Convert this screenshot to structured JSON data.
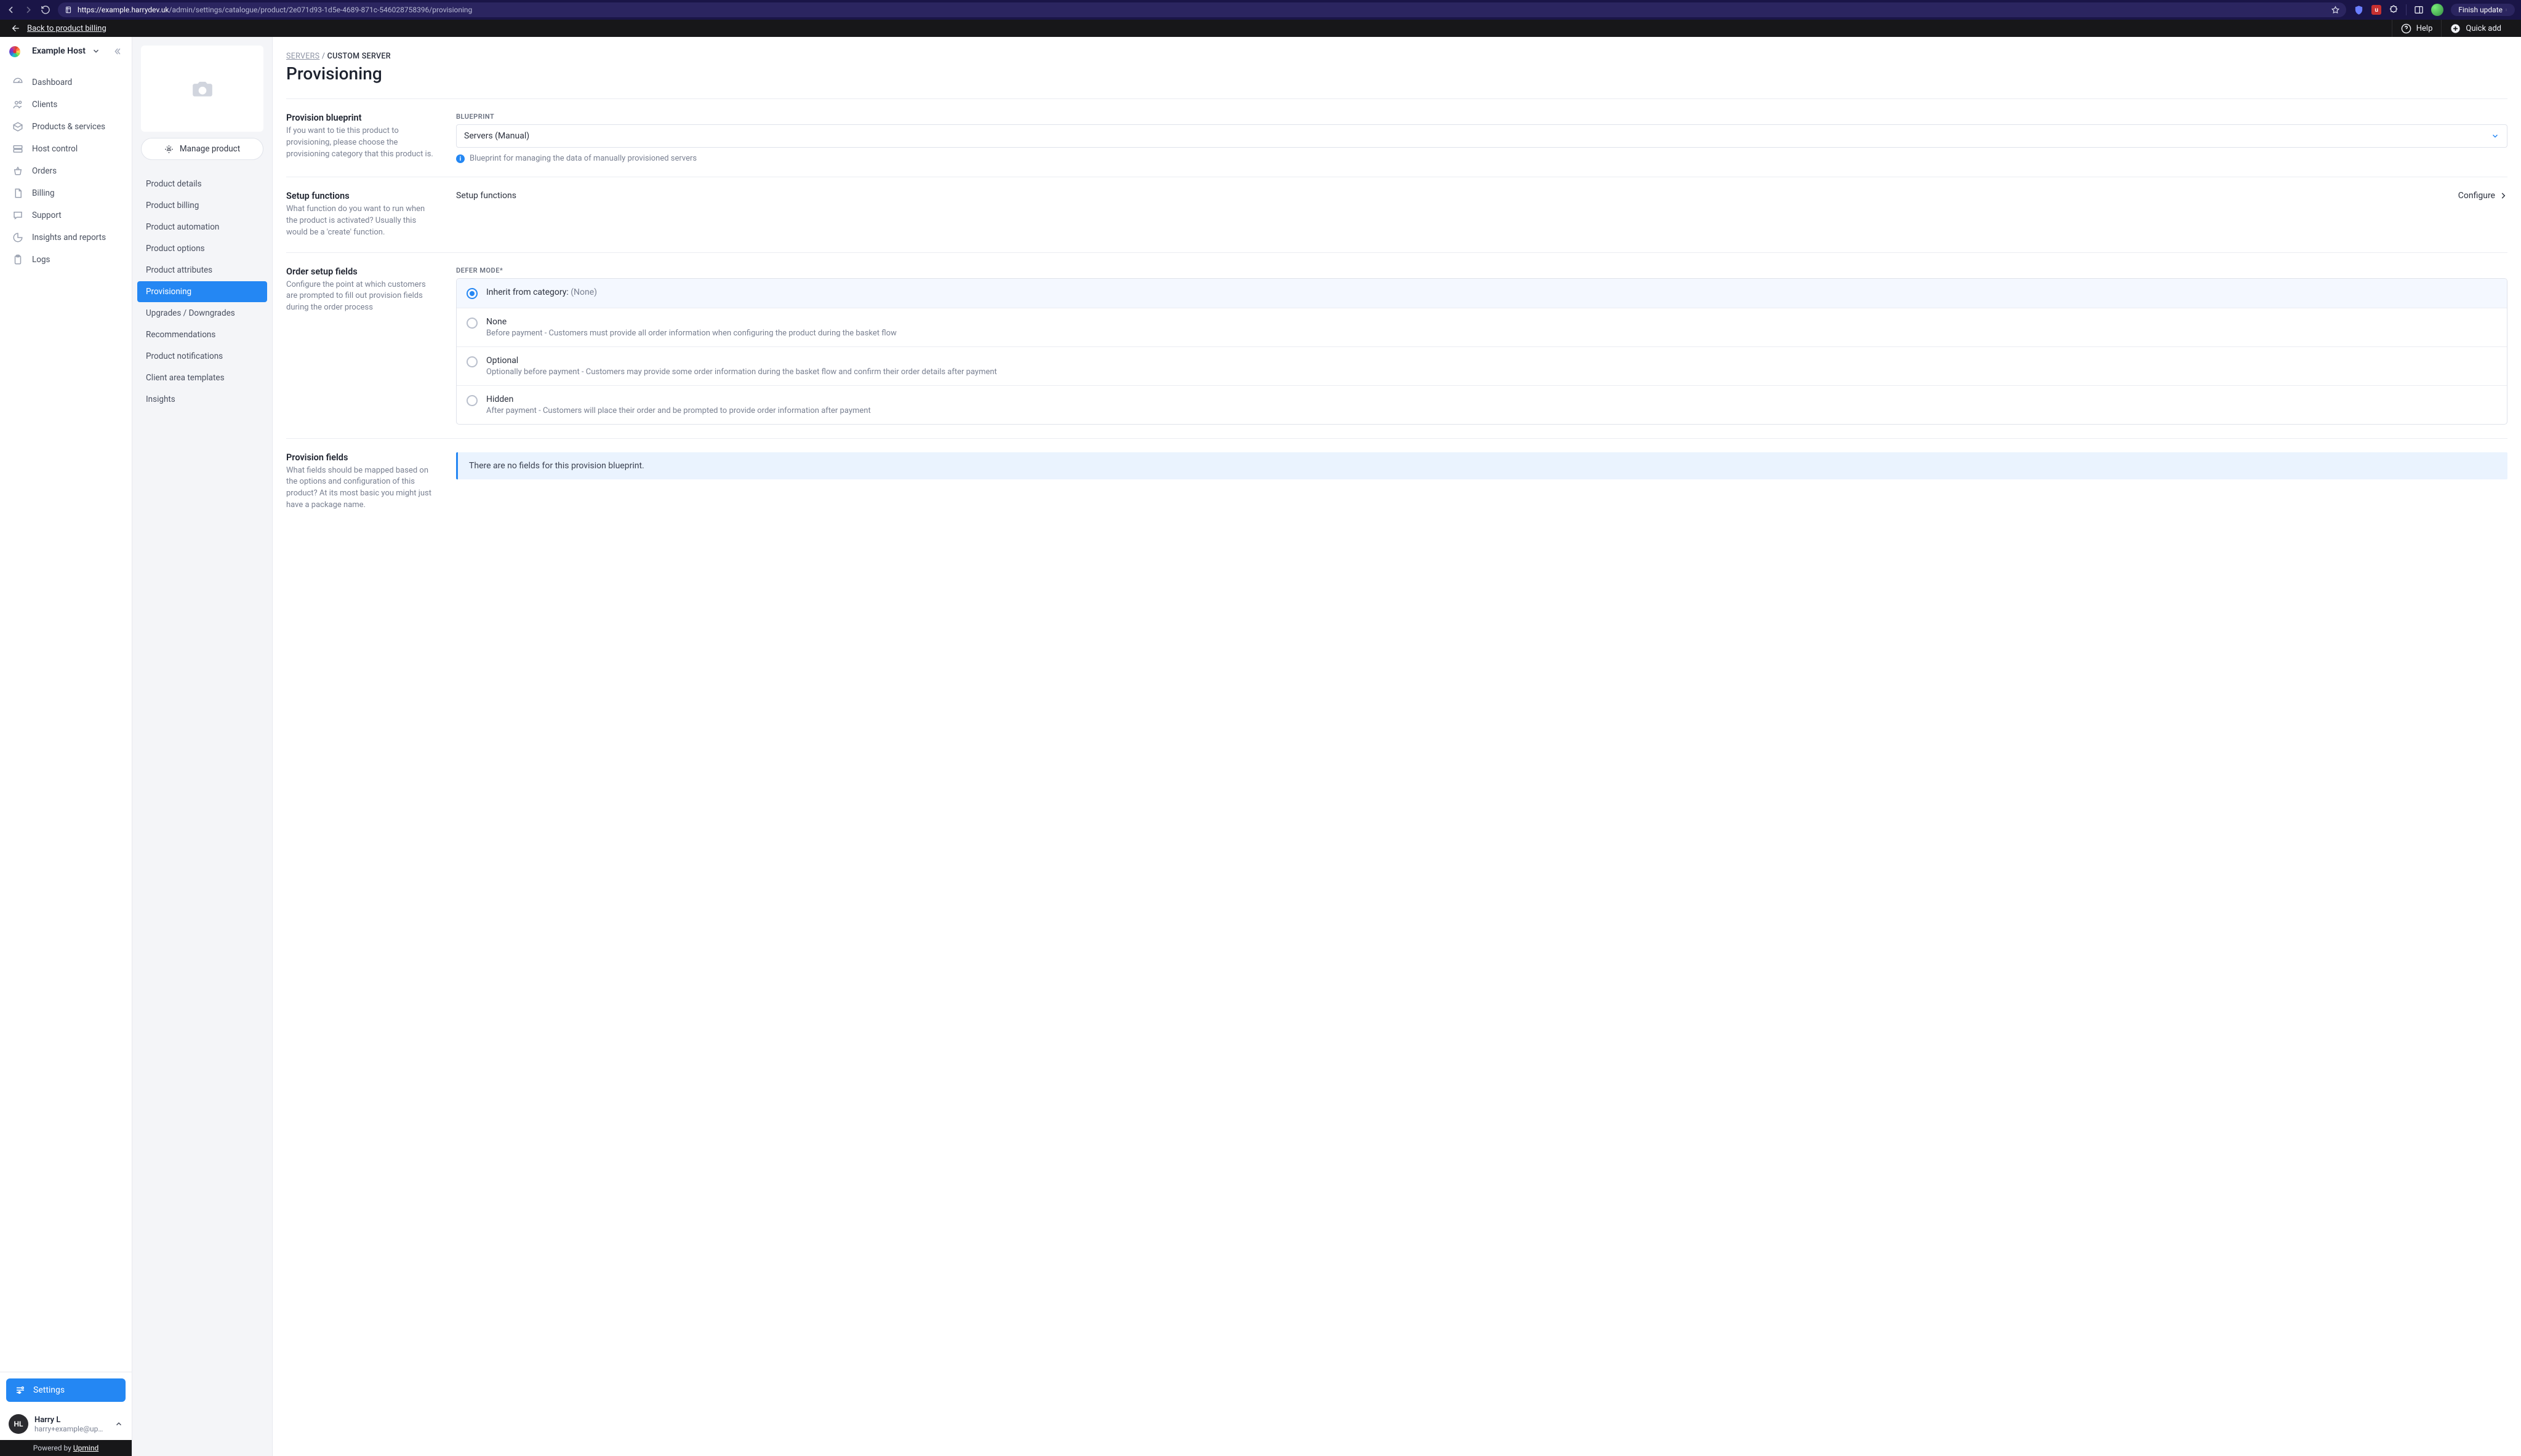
{
  "browser": {
    "url_protocol_host": "https://example.harrydev.uk",
    "url_path": "/admin/settings/catalogue/product/2e071d93-1d5e-4689-871c-546028758396/provisioning",
    "update_label": "Finish update"
  },
  "topbar": {
    "back_label": "Back to product billing",
    "help_label": "Help",
    "quick_add_label": "Quick add"
  },
  "sidebar": {
    "org_name": "Example Host",
    "nav": [
      {
        "label": "Dashboard",
        "icon": "gauge"
      },
      {
        "label": "Clients",
        "icon": "users"
      },
      {
        "label": "Products & services",
        "icon": "box"
      },
      {
        "label": "Host control",
        "icon": "server"
      },
      {
        "label": "Orders",
        "icon": "basket"
      },
      {
        "label": "Billing",
        "icon": "document"
      },
      {
        "label": "Support",
        "icon": "chat"
      },
      {
        "label": "Insights and reports",
        "icon": "pie"
      },
      {
        "label": "Logs",
        "icon": "clipboard"
      }
    ],
    "settings_label": "Settings",
    "user": {
      "initials": "HL",
      "name": "Harry L",
      "email": "harry+example@upmind...."
    },
    "powered_prefix": "Powered by ",
    "powered_link": "Upmind"
  },
  "panel": {
    "manage_label": "Manage product",
    "tabs": [
      "Product details",
      "Product billing",
      "Product automation",
      "Product options",
      "Product attributes",
      "Provisioning",
      "Upgrades / Downgrades",
      "Recommendations",
      "Product notifications",
      "Client area templates",
      "Insights"
    ],
    "active_tab_index": 5
  },
  "page": {
    "breadcrumb_parent": "SERVERS",
    "breadcrumb_current": "CUSTOM SERVER",
    "title": "Provisioning",
    "sections": {
      "blueprint": {
        "title": "Provision blueprint",
        "desc": "If you want to tie this product to provisioning, please choose the provisioning category that this product is.",
        "field_label": "BLUEPRINT",
        "value": "Servers (Manual)",
        "hint": "Blueprint for managing the data of manually provisioned servers"
      },
      "setup_functions": {
        "title": "Setup functions",
        "desc": "What function do you want to run when the product is activated? Usually this would be a 'create' function.",
        "row_label": "Setup functions",
        "row_action": "Configure"
      },
      "defer": {
        "title": "Order setup fields",
        "desc": "Configure the point at which customers are prompted to fill out provision fields during the order process",
        "field_label": "DEFER MODE",
        "options": [
          {
            "label_prefix": "Inherit from category: ",
            "label_value": "(None)",
            "sub": ""
          },
          {
            "label_prefix": "None",
            "label_value": "",
            "sub": "Before payment - Customers must provide all order information when configuring the product during the basket flow"
          },
          {
            "label_prefix": "Optional",
            "label_value": "",
            "sub": "Optionally before payment - Customers may provide some order information during the basket flow and confirm their order details after payment"
          },
          {
            "label_prefix": "Hidden",
            "label_value": "",
            "sub": "After payment - Customers will place their order and be prompted to provide order information after payment"
          }
        ],
        "selected_index": 0
      },
      "fields": {
        "title": "Provision fields",
        "desc": "What fields should be mapped based on the options and configuration of this product? At its most basic you might just have a package name.",
        "banner": "There are no fields for this provision blueprint."
      }
    }
  }
}
